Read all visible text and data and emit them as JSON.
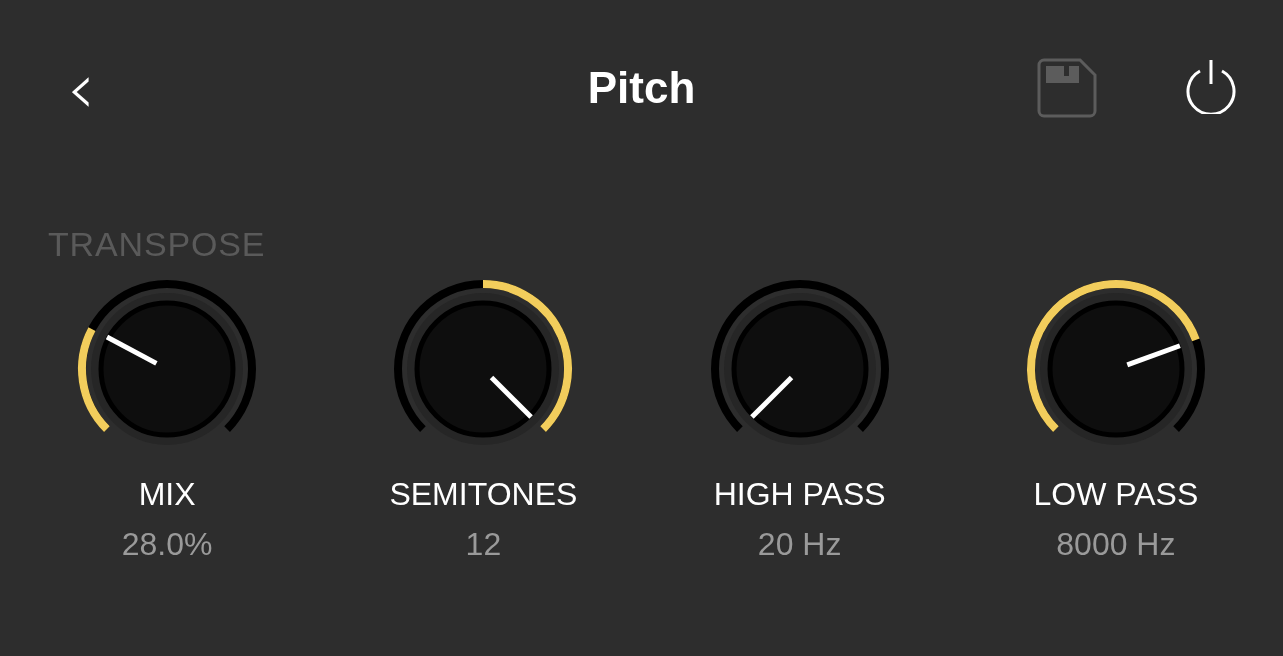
{
  "header": {
    "back": "‹",
    "title": "Pitch"
  },
  "section": "TRANSPOSE",
  "knobs": [
    {
      "label": "MIX",
      "reading": "28.0%"
    },
    {
      "label": "SEMITONES",
      "reading": "12"
    },
    {
      "label": "HIGH PASS",
      "reading": "20 Hz"
    },
    {
      "label": "LOW PASS",
      "reading": "8000 Hz"
    }
  ]
}
